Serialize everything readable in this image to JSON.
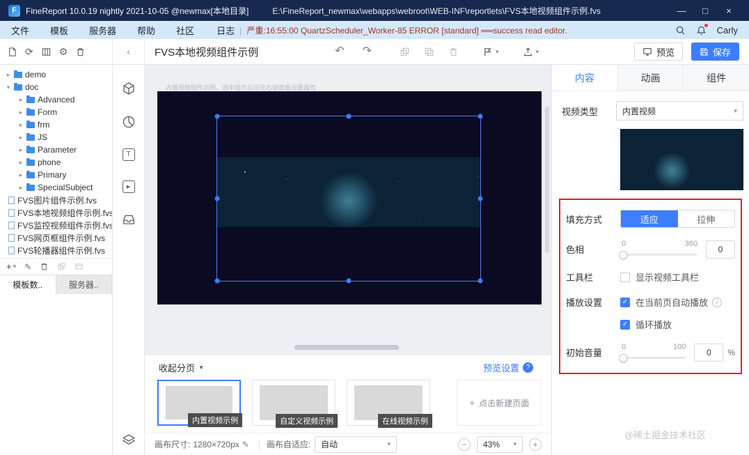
{
  "colors": {
    "accent": "#3d7eff",
    "annotation_red": "#e0231b",
    "titlebar_bg": "#17294e",
    "menubar_bg": "#d5e8f9"
  },
  "icons": {
    "caret_down": "▾",
    "chevron_right": "▸",
    "chevron_left": "‹",
    "collapse_caret": "▼",
    "undo": "↶",
    "redo": "↷",
    "check": "✓",
    "plus": "+",
    "minus": "−",
    "pencil": "✎",
    "question": "?",
    "info": "i",
    "refresh": "⟳",
    "gear": "⚙",
    "play": "▶",
    "text_tool": "T",
    "window_min": "—",
    "window_max": "□",
    "window_close": "×",
    "divider": "|"
  },
  "titlebar": {
    "logo_letter": "F",
    "app_title": "FineReport 10.0.19 nightly 2021-10-05 @newmax[本地目录]",
    "file_path": "E:\\FineReport_newmax\\webapps\\webroot\\WEB-INF\\reportlets\\FVS本地视频组件示例.fvs"
  },
  "menubar": {
    "items": [
      "文件",
      "模板",
      "服务器",
      "帮助",
      "社区"
    ],
    "log_label": "日志",
    "log_message": "严重:16:55:00 QuartzScheduler_Worker-85 ERROR [standard] ══success read editor.tpl: rep...",
    "user": "Carly"
  },
  "toolbar": {
    "doc_title": "FVS本地视频组件示例",
    "preview_label": "预览",
    "save_label": "保存"
  },
  "sidebar": {
    "folders": [
      {
        "label": "demo"
      },
      {
        "label": "doc"
      },
      {
        "label": "Advanced"
      },
      {
        "label": "Form"
      },
      {
        "label": "frm"
      },
      {
        "label": "JS"
      },
      {
        "label": "Parameter"
      },
      {
        "label": "phone"
      },
      {
        "label": "Primary"
      },
      {
        "label": "SpecialSubject"
      }
    ],
    "files": [
      {
        "label": "FVS图片组件示例.fvs"
      },
      {
        "label": "FVS本地视频组件示例.fvs"
      },
      {
        "label": "FVS监控视频组件示例.fvs"
      },
      {
        "label": "FVS网页框组件示例.fvs"
      },
      {
        "label": "FVS轮播器组件示例.fvs"
      }
    ],
    "tabs": [
      {
        "label": "模板数.."
      },
      {
        "label": "服务器.."
      }
    ]
  },
  "canvas": {
    "hint": "内置视频组件示例，选中组件后可在右侧面板设置属性"
  },
  "pages": {
    "collapse_label": "收起分页",
    "preview_settings_label": "预览设置",
    "thumbs": [
      {
        "label": "内置视频示例"
      },
      {
        "label": "自定义视频示例"
      },
      {
        "label": "在线视频示例"
      }
    ],
    "new_page_label": "点击新建页面"
  },
  "statusbar": {
    "size_label": "画布尺寸:",
    "size_value": "1280×720px",
    "fit_label": "画布自适应:",
    "fit_value": "自动",
    "zoom_value": "43%"
  },
  "panel": {
    "tabs": [
      {
        "label": "内容"
      },
      {
        "label": "动画"
      },
      {
        "label": "组件"
      }
    ],
    "video_type": {
      "label": "视频类型",
      "value": "内置视频"
    },
    "fill": {
      "label": "填充方式",
      "options": [
        {
          "label": "适应"
        },
        {
          "label": "拉伸"
        }
      ]
    },
    "hue": {
      "label": "色相",
      "min": "0",
      "max": "360",
      "value": "0"
    },
    "toolbar_row": {
      "label": "工具栏",
      "checkbox_label": "显示视频工具栏"
    },
    "play": {
      "label": "播放设置",
      "autoplay_label": "在当前页自动播放",
      "loop_label": "循环播放"
    },
    "volume": {
      "label": "初始音量",
      "min": "0",
      "max": "100",
      "value": "0",
      "unit": "%"
    }
  },
  "watermark": {
    "text": "@稀土掘金技术社区"
  }
}
